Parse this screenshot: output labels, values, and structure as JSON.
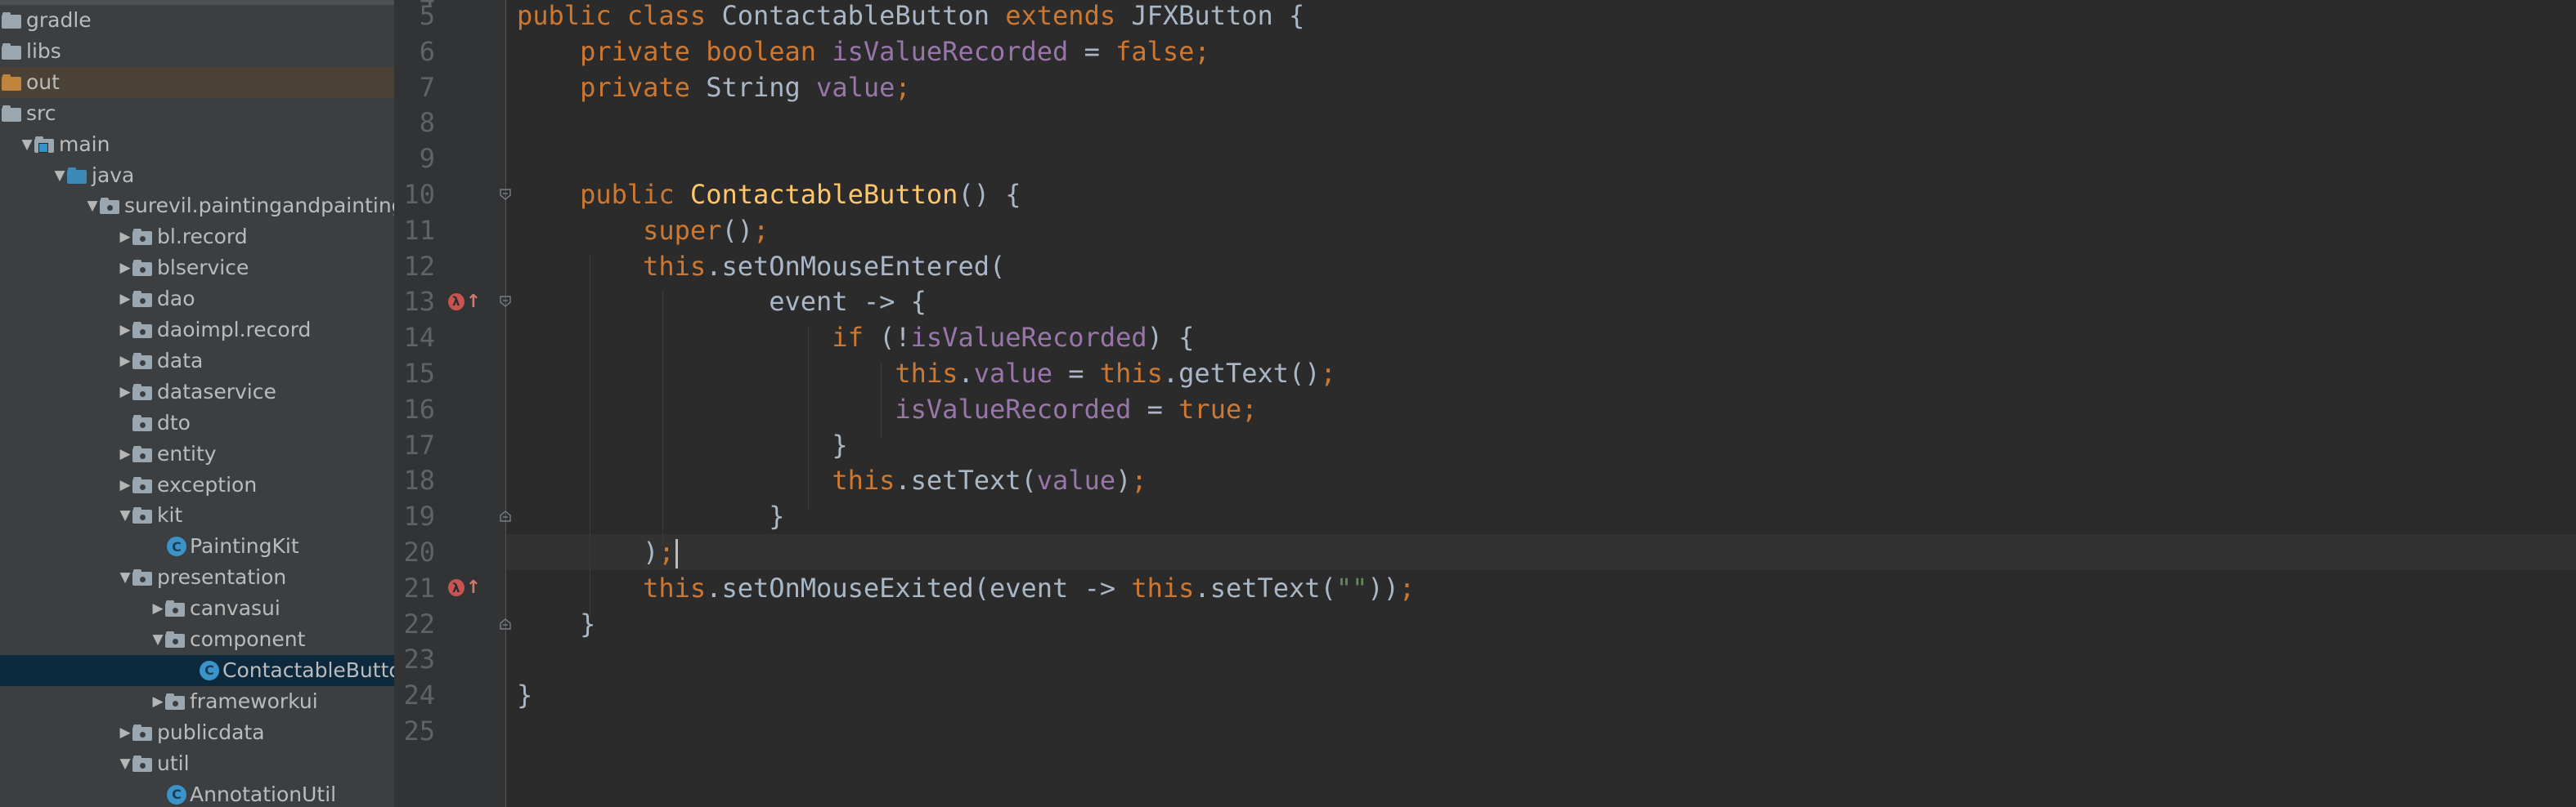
{
  "project_tree": {
    "items": [
      {
        "label": "gradle",
        "icon": "folder-icon",
        "state": "collapsed"
      },
      {
        "label": "libs",
        "icon": "folder-icon",
        "state": "collapsed"
      },
      {
        "label": "out",
        "icon": "excluded-folder-icon",
        "state": "collapsed"
      },
      {
        "label": "src",
        "icon": "folder-icon",
        "state": "expanded"
      },
      {
        "label": "main",
        "icon": "module-folder-icon",
        "state": "expanded"
      },
      {
        "label": "java",
        "icon": "source-folder-icon",
        "state": "expanded"
      },
      {
        "label": "surevil.paintingandpainting",
        "icon": "package-icon",
        "state": "expanded"
      },
      {
        "label": "bl.record",
        "icon": "package-icon",
        "state": "collapsed"
      },
      {
        "label": "blservice",
        "icon": "package-icon",
        "state": "collapsed"
      },
      {
        "label": "dao",
        "icon": "package-icon",
        "state": "collapsed"
      },
      {
        "label": "daoimpl.record",
        "icon": "package-icon",
        "state": "collapsed"
      },
      {
        "label": "data",
        "icon": "package-icon",
        "state": "collapsed"
      },
      {
        "label": "dataservice",
        "icon": "package-icon",
        "state": "collapsed"
      },
      {
        "label": "dto",
        "icon": "package-icon",
        "state": "leaf"
      },
      {
        "label": "entity",
        "icon": "package-icon",
        "state": "collapsed"
      },
      {
        "label": "exception",
        "icon": "package-icon",
        "state": "collapsed"
      },
      {
        "label": "kit",
        "icon": "package-icon",
        "state": "expanded"
      },
      {
        "label": "PaintingKit",
        "icon": "class-icon",
        "state": "leaf"
      },
      {
        "label": "presentation",
        "icon": "package-icon",
        "state": "expanded"
      },
      {
        "label": "canvasui",
        "icon": "package-icon",
        "state": "collapsed"
      },
      {
        "label": "component",
        "icon": "package-icon",
        "state": "expanded"
      },
      {
        "label": "ContactableButto",
        "icon": "class-icon",
        "state": "leaf",
        "selected": true
      },
      {
        "label": "frameworkui",
        "icon": "package-icon",
        "state": "collapsed"
      },
      {
        "label": "publicdata",
        "icon": "package-icon",
        "state": "collapsed"
      },
      {
        "label": "util",
        "icon": "package-icon",
        "state": "expanded"
      },
      {
        "label": "AnnotationUtil",
        "icon": "class-icon",
        "state": "leaf"
      }
    ],
    "class_icon_letter": "C"
  },
  "editor": {
    "partial_top_line_number": "4",
    "line_numbers": [
      "5",
      "6",
      "7",
      "8",
      "9",
      "10",
      "11",
      "12",
      "13",
      "14",
      "15",
      "16",
      "17",
      "18",
      "19",
      "20",
      "21",
      "22",
      "23",
      "24",
      "25"
    ],
    "lines": [
      [
        {
          "t": "public class ",
          "c": "kw"
        },
        {
          "t": "ContactableButton ",
          "c": "plain"
        },
        {
          "t": "extends ",
          "c": "kw"
        },
        {
          "t": "JFXButton {",
          "c": "plain"
        }
      ],
      [
        {
          "t": "    private boolean ",
          "c": "kw"
        },
        {
          "t": "isValueRecorded",
          "c": "fld"
        },
        {
          "t": " = ",
          "c": "plain"
        },
        {
          "t": "false",
          "c": "kw"
        },
        {
          "t": ";",
          "c": "kw"
        }
      ],
      [
        {
          "t": "    private ",
          "c": "kw"
        },
        {
          "t": "String ",
          "c": "plain"
        },
        {
          "t": "value",
          "c": "fld"
        },
        {
          "t": ";",
          "c": "kw"
        }
      ],
      [],
      [],
      [
        {
          "t": "    public ",
          "c": "kw"
        },
        {
          "t": "ContactableButton",
          "c": "fn"
        },
        {
          "t": "() {",
          "c": "plain"
        }
      ],
      [
        {
          "t": "        super",
          "c": "kw"
        },
        {
          "t": "()",
          "c": "plain"
        },
        {
          "t": ";",
          "c": "kw"
        }
      ],
      [
        {
          "t": "        this",
          "c": "kw"
        },
        {
          "t": ".setOnMouseEntered(",
          "c": "plain"
        }
      ],
      [
        {
          "t": "                event -> {",
          "c": "plain"
        }
      ],
      [
        {
          "t": "                    if ",
          "c": "kw"
        },
        {
          "t": "(!",
          "c": "plain"
        },
        {
          "t": "isValueRecorded",
          "c": "fld"
        },
        {
          "t": ") {",
          "c": "plain"
        }
      ],
      [
        {
          "t": "                        this",
          "c": "kw"
        },
        {
          "t": ".",
          "c": "plain"
        },
        {
          "t": "value",
          "c": "fld"
        },
        {
          "t": " = ",
          "c": "plain"
        },
        {
          "t": "this",
          "c": "kw"
        },
        {
          "t": ".getText()",
          "c": "plain"
        },
        {
          "t": ";",
          "c": "kw"
        }
      ],
      [
        {
          "t": "                        isValueRecorded",
          "c": "fld"
        },
        {
          "t": " = ",
          "c": "plain"
        },
        {
          "t": "true",
          "c": "kw"
        },
        {
          "t": ";",
          "c": "kw"
        }
      ],
      [
        {
          "t": "                    }",
          "c": "plain"
        }
      ],
      [
        {
          "t": "                    this",
          "c": "kw"
        },
        {
          "t": ".setText(",
          "c": "plain"
        },
        {
          "t": "value",
          "c": "fld"
        },
        {
          "t": ")",
          "c": "plain"
        },
        {
          "t": ";",
          "c": "kw"
        }
      ],
      [
        {
          "t": "                }",
          "c": "plain"
        }
      ],
      [
        {
          "t": "        )",
          "c": "plain"
        },
        {
          "t": ";",
          "c": "kw"
        },
        {
          "t": "",
          "c": "caret"
        }
      ],
      [
        {
          "t": "        this",
          "c": "kw"
        },
        {
          "t": ".setOnMouseExited(event -> ",
          "c": "plain"
        },
        {
          "t": "this",
          "c": "kw"
        },
        {
          "t": ".setText(",
          "c": "plain"
        },
        {
          "t": "\"\"",
          "c": "str"
        },
        {
          "t": "))",
          "c": "plain"
        },
        {
          "t": ";",
          "c": "kw"
        }
      ],
      [
        {
          "t": "    }",
          "c": "plain"
        }
      ],
      [],
      [
        {
          "t": "}",
          "c": "plain"
        }
      ],
      []
    ],
    "caret_line": "20",
    "gutter_markers": [
      {
        "line": "13",
        "icon": "lambda-override-icon",
        "badge": "λ"
      },
      {
        "line": "21",
        "icon": "lambda-override-icon",
        "badge": "λ"
      }
    ],
    "colors": {
      "background": "#2b2b2b",
      "keyword": "#cc7832",
      "field": "#9876aa",
      "method_declaration": "#ffc66d",
      "string": "#6a8759",
      "plain": "#a9b7c6",
      "line_number": "#606366"
    }
  }
}
